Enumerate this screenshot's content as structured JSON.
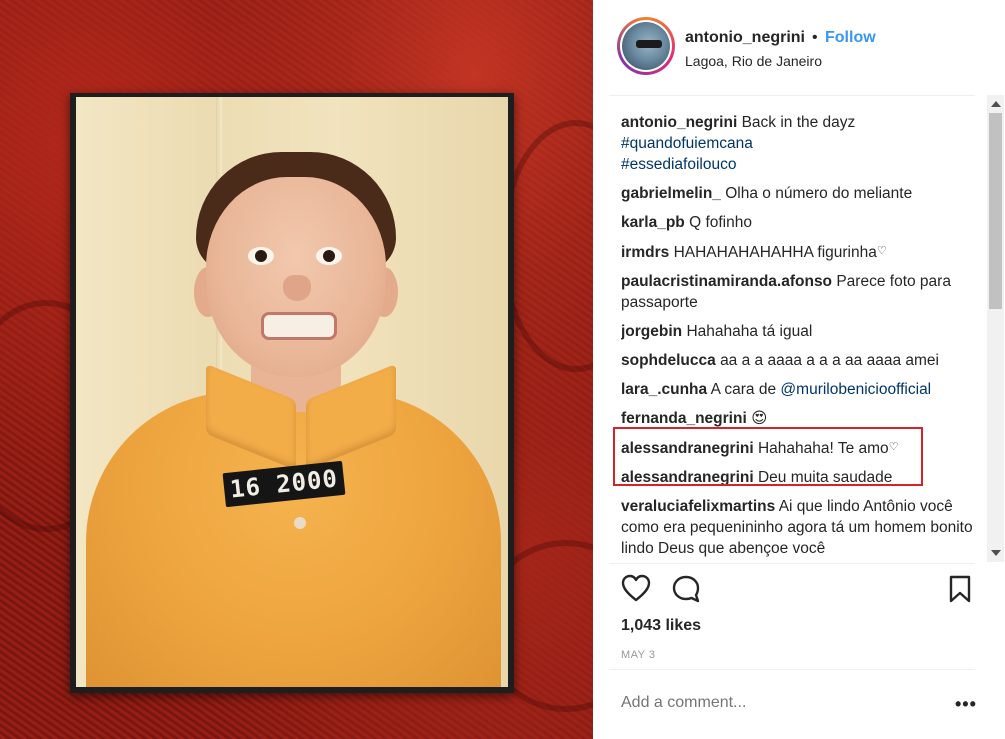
{
  "photo": {
    "plate_number": "16 2000"
  },
  "header": {
    "username": "antonio_negrini",
    "separator": "•",
    "follow_label": "Follow",
    "location": "Lagoa, Rio de Janeiro"
  },
  "caption": {
    "username": "antonio_negrini",
    "text": "Back in the dayz",
    "hashtags": [
      "#quandofuiemcana",
      "#essediafoilouco"
    ]
  },
  "comments": [
    {
      "username": "gabrielmelin_",
      "text": "Olha o número do meliante"
    },
    {
      "username": "karla_pb",
      "text": "Q fofinho"
    },
    {
      "username": "irmdrs",
      "text": "HAHAHAHAHAHHA figurinha"
    },
    {
      "username": "paulacristinamiranda.afonso",
      "text": "Parece foto para passaporte"
    },
    {
      "username": "jorgebin",
      "text": "Hahahaha tá igual"
    },
    {
      "username": "sophdelucca",
      "text": "aa a a aaaa a a a aa aaaa amei"
    },
    {
      "username": "lara_.cunha",
      "text": "A cara de",
      "mention": "@murilobenicioofficial"
    },
    {
      "username": "fernanda_negrini",
      "text": "😍"
    },
    {
      "username": "alessandranegrini",
      "text": "Hahahaha! Te amo"
    },
    {
      "username": "alessandranegrini",
      "text": "Deu muita saudade"
    },
    {
      "username": "veraluciafelixmartins",
      "text": "Ai que lindo Antônio você como era pequenininho agora tá um homem bonito lindo Deus que abençoe você"
    }
  ],
  "actions": {
    "like_icon": "heart-outline-icon",
    "comment_icon": "speech-bubble-icon",
    "save_icon": "bookmark-icon"
  },
  "likes_text": "1,043 likes",
  "date_text": "MAY 3",
  "comment_box": {
    "placeholder": "Add a comment...",
    "more_label": "•••"
  },
  "colors": {
    "link": "#003569",
    "follow": "#3897f0",
    "highlight": "#d6232a"
  }
}
